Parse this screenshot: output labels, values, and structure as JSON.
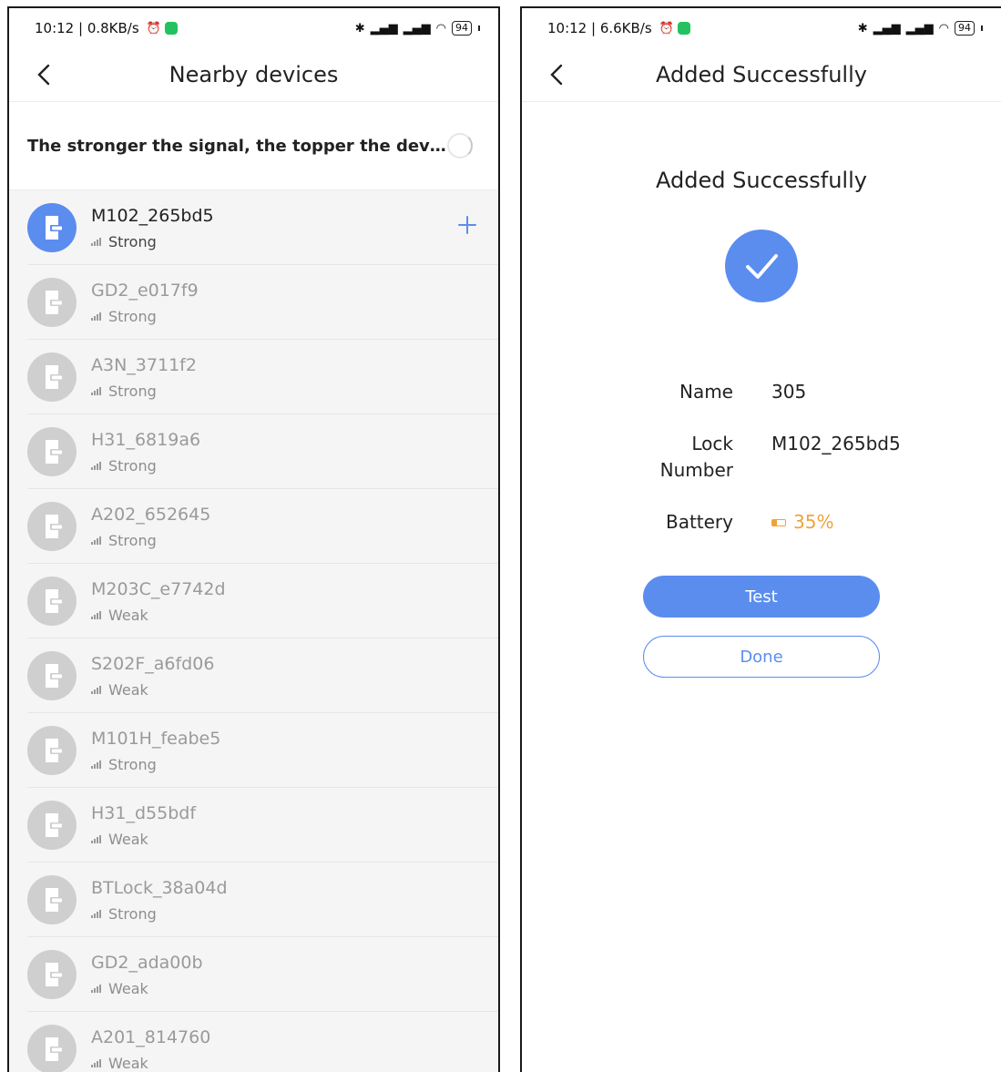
{
  "left": {
    "status": {
      "time": "10:12 | 0.8KB/s",
      "battery": "94"
    },
    "title": "Nearby devices",
    "hint": "The stronger the signal, the topper the devic...",
    "devices": [
      {
        "name": "M102_265bd5",
        "signal": "Strong",
        "active": true
      },
      {
        "name": "GD2_e017f9",
        "signal": "Strong"
      },
      {
        "name": "A3N_3711f2",
        "signal": "Strong"
      },
      {
        "name": "H31_6819a6",
        "signal": "Strong"
      },
      {
        "name": "A202_652645",
        "signal": "Strong"
      },
      {
        "name": "M203C_e7742d",
        "signal": "Weak"
      },
      {
        "name": "S202F_a6fd06",
        "signal": "Weak"
      },
      {
        "name": "M101H_feabe5",
        "signal": "Strong"
      },
      {
        "name": "H31_d55bdf",
        "signal": "Weak"
      },
      {
        "name": "BTLock_38a04d",
        "signal": "Strong"
      },
      {
        "name": "GD2_ada00b",
        "signal": "Weak"
      },
      {
        "name": "A201_814760",
        "signal": "Weak"
      }
    ]
  },
  "right": {
    "status": {
      "time": "10:12 | 6.6KB/s",
      "battery": "94"
    },
    "title": "Added Successfully",
    "heading": "Added Successfully",
    "name_label": "Name",
    "name_value": "305",
    "lock_label_1": "Lock",
    "lock_label_2": "Number",
    "lock_value": "M102_265bd5",
    "battery_label": "Battery",
    "battery_value": "35%",
    "battery_level": 0.35,
    "test_label": "Test",
    "done_label": "Done"
  },
  "colors": {
    "accent": "#5b8def",
    "battery_warn": "#f0a23a",
    "inactive": "#cfcfcf"
  }
}
